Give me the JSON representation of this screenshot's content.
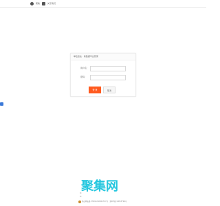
{
  "topbar": {
    "item1": "帮助",
    "item2": "关于我们"
  },
  "left_badge": {
    "label": ""
  },
  "login": {
    "title": "单击您在 · 新数据平台登录",
    "username_label": "用户名：",
    "password_label": "密码：",
    "username_value": "",
    "password_value": "",
    "username_placeholder": "",
    "password_placeholder": "",
    "submit_label": "登 录",
    "cancel_label": "取消"
  },
  "footer": {
    "brand": "聚集网",
    "line1": "IC",
    "line2": "IC",
    "police": "浙公网安备 33010202001747号 · 浙ICP备 10053799号"
  },
  "colors": {
    "accent": "#ff5a1f",
    "brand": "#26c7df",
    "badge": "#3b79d8"
  }
}
